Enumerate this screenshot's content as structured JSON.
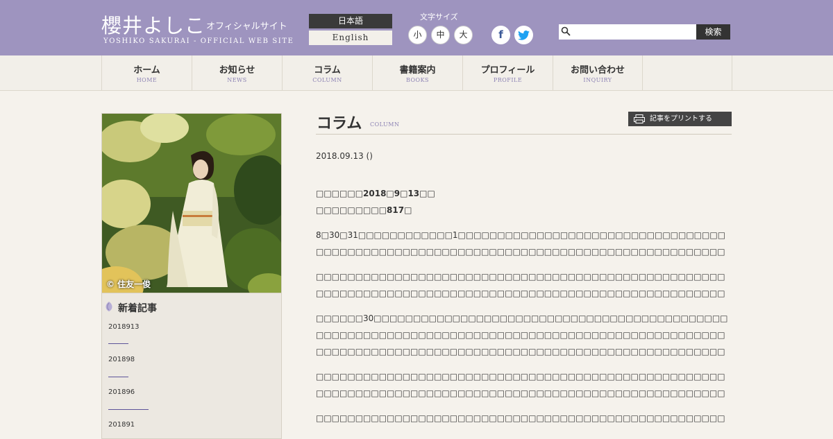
{
  "header": {
    "logo_jp": "櫻井よしこ",
    "logo_sub": "オフィシャルサイト",
    "logo_en": "YOSHIKO SAKURAI - OFFICIAL WEB SITE",
    "lang_jp": "日本語",
    "lang_en": "English",
    "font_size_label": "文字サイズ",
    "font_small": "小",
    "font_medium": "中",
    "font_large": "大",
    "facebook": "f",
    "twitter": "t",
    "search_value": "",
    "search_button": "検索",
    "colors": {
      "header_bg": "#9e94bf",
      "accent": "#5c5399"
    }
  },
  "nav": [
    {
      "jp": "ホーム",
      "en": "HOME"
    },
    {
      "jp": "お知らせ",
      "en": "NEWS"
    },
    {
      "jp": "コラム",
      "en": "COLUMN"
    },
    {
      "jp": "書籍案内",
      "en": "BOOKS"
    },
    {
      "jp": "プロフィール",
      "en": "PROFILE"
    },
    {
      "jp": "お問い合わせ",
      "en": "INQUIRY"
    }
  ],
  "sidebar": {
    "photo_credit": "© 住友一俊",
    "section_title": "新着記事",
    "items": [
      "2018913",
      "201898",
      "201896",
      "201891"
    ]
  },
  "main": {
    "title": "コラム",
    "title_en": "COLUMN",
    "print_button": "記事をプリントする",
    "date": "2018.09.13 ()",
    "line1": "□□□□□□2018□9□13□□",
    "line2": "□□□□□□□□□817□",
    "para1": "8□30□31□□□□□□□□□□□□1□□□□□□□□□□□□□□□□□□□□□□□□□□□□□□□□□□□□□□□□□□□□□□□□□□□□□□□□□□□□□□□□□□□□□□□□□□□□□□□□□□□□□□□□□□□□□□□□",
    "para2": "□□□□□□□□□□□□□□□□□□□□□□□□□□□□□□□□□□□□□□□□□□□□□□□□□□□□□□□□□□□□□□□□□□□□□□□□□□□□□□□□□□□□□□□□□□□□□□□□□□□□□□□□□□□□□□□□□□□□□□□□□□□□□",
    "para3": "□□□□□□30□□□□□□□□□□□□□□□□□□□□□□□□□□□□□□□□□□□□□□□□□□□□□□□□□□□□□□□□□□□□□□□□□□□□□□□□□□□□□□□□□□□□□□□□□□□□□□□□□□□□□□□□□□□□□□□□□□□□□□□□□□□□□□□□□□□□□□□□□□□□□□□□□□□□□□□□□□□□□□□□□□",
    "para4": "□□□□□□□□□□□□□□□□□□□□□□□□□□□□□□□□□□□□□□□□□□□□□□□□□□□□□□□□□□□□□□□□□□□□□□□□□□□□□□□□□□□□□□□□□□□□□□□□□□□□□□□□□□□□□□□□□□□□□□□□□□□□□□□□□□□□□□□□□□□□□□□□□□",
    "para5": "□□□□□□□□□□□□□□□□□□□□□□□□□□□□□□□□□□□□□□□□□□□□□□□□□□□□□□□□□□□□□□□□□"
  }
}
